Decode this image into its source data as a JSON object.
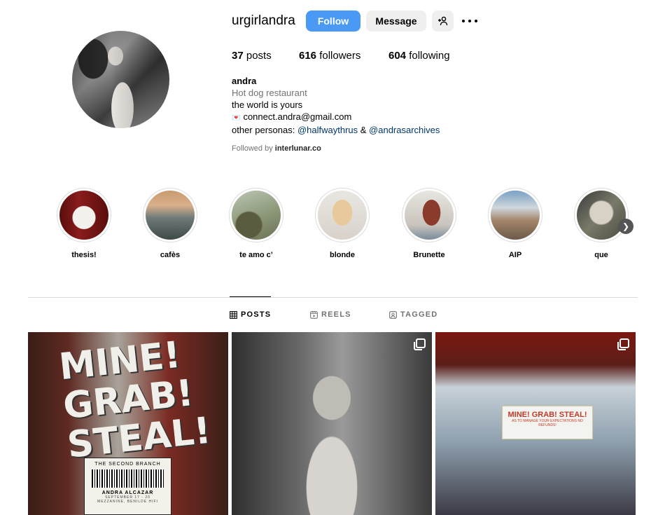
{
  "profile": {
    "username": "urgirlandra",
    "follow_label": "Follow",
    "message_label": "Message",
    "stats": {
      "posts_count": "37",
      "posts_label": "posts",
      "followers_count": "616",
      "followers_label": "followers",
      "following_count": "604",
      "following_label": "following"
    },
    "bio": {
      "name": "andra",
      "category": "Hot dog restaurant",
      "line1": "the world is yours",
      "email": "connect.andra@gmail.com",
      "personas_prefix": "other personas: ",
      "persona1": "@halfwaythrus",
      "amp": " & ",
      "persona2": "@andrasarchives"
    },
    "followed_by_prefix": "Followed by ",
    "followed_by_user": "interlunar.co"
  },
  "highlights": [
    {
      "label": "thesis!"
    },
    {
      "label": "cafès"
    },
    {
      "label": "te amo c’"
    },
    {
      "label": "blonde"
    },
    {
      "label": "Brunette"
    },
    {
      "label": "AIP"
    },
    {
      "label": "que"
    }
  ],
  "tabs": {
    "posts": "POSTS",
    "reels": "REELS",
    "tagged": "TAGGED"
  },
  "posts": {
    "p1": {
      "headline": "MINE! GRAB! STEAL!",
      "tag_title": "THE SECOND BRANCH",
      "tag_author": "ANDRA ALCAZAR",
      "tag_dates": "SEPTEMBER 17 - 20",
      "tag_venue": "MEZZANINE, BENILDE HIFI"
    },
    "p3": {
      "banner_title": "MINE! GRAB! STEAL!",
      "banner_sub": "AS TO MANAGE YOUR EXPECTATIONS NO REFUNDS!"
    }
  },
  "colors": {
    "follow_button": "#4a9af5",
    "link": "#00376b",
    "muted_text": "#737373"
  }
}
